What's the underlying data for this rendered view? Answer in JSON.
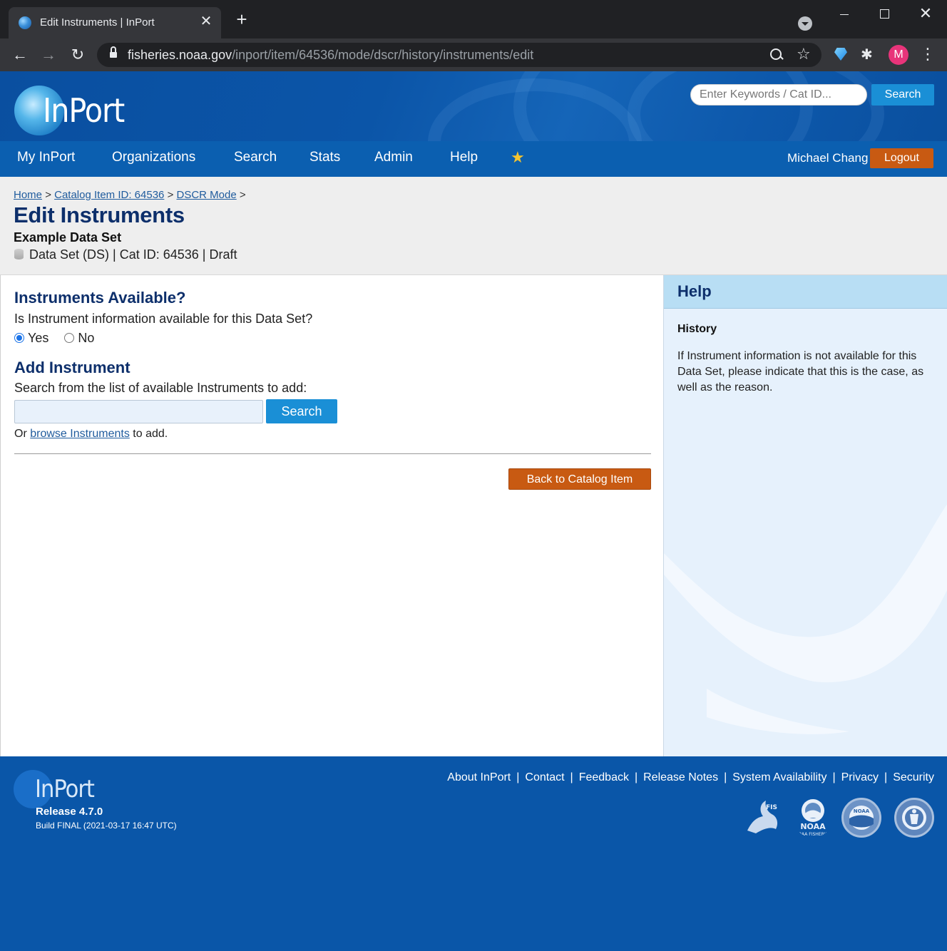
{
  "browser": {
    "tab_title": "Edit Instruments | InPort",
    "url_host": "fisheries.noaa.gov",
    "url_path": "/inport/item/64536/mode/dscr/history/instruments/edit",
    "avatar_letter": "M"
  },
  "header": {
    "logo_text": "InPort",
    "search_placeholder": "Enter Keywords / Cat ID...",
    "search_button": "Search"
  },
  "nav": {
    "items": [
      "My InPort",
      "Organizations",
      "Search",
      "Stats",
      "Admin",
      "Help"
    ],
    "user_name": "Michael Chang",
    "logout": "Logout"
  },
  "title_band": {
    "breadcrumb": [
      "Home",
      "Catalog Item ID: 64536",
      "DSCR Mode"
    ],
    "breadcrumb_sep": ">",
    "page_title": "Edit Instruments",
    "item_name": "Example Data Set",
    "item_meta": "Data Set (DS) | Cat ID: 64536 | Draft"
  },
  "content": {
    "instruments_heading": "Instruments Available?",
    "instruments_question": "Is Instrument information available for this Data Set?",
    "radio_yes": "Yes",
    "radio_no": "No",
    "selected": "Yes",
    "add_heading": "Add Instrument",
    "add_prompt": "Search from the list of available Instruments to add:",
    "search_button": "Search",
    "or_prefix": "Or",
    "browse_link": "browse Instruments",
    "or_suffix": "to add.",
    "back_button": "Back to Catalog Item"
  },
  "help": {
    "title": "Help",
    "subtitle": "History",
    "body": "If Instrument information is not available for this Data Set, please indicate that this is the case, as well as the reason."
  },
  "footer": {
    "logo_text": "InPort",
    "release": "Release 4.7.0",
    "build": "Build FINAL (2021-03-17 16:47 UTC)",
    "links": [
      "About InPort",
      "Contact",
      "Feedback",
      "Release Notes",
      "System Availability",
      "Privacy",
      "Security"
    ],
    "seal_labels": [
      "FIS",
      "NOAA",
      "NOAA FISHERIES",
      "NOAA"
    ]
  },
  "colors": {
    "brand_blue": "#0b5fb0",
    "accent_orange": "#c85a12",
    "button_blue": "#1a8fd6",
    "title_navy": "#0d2f6b"
  }
}
